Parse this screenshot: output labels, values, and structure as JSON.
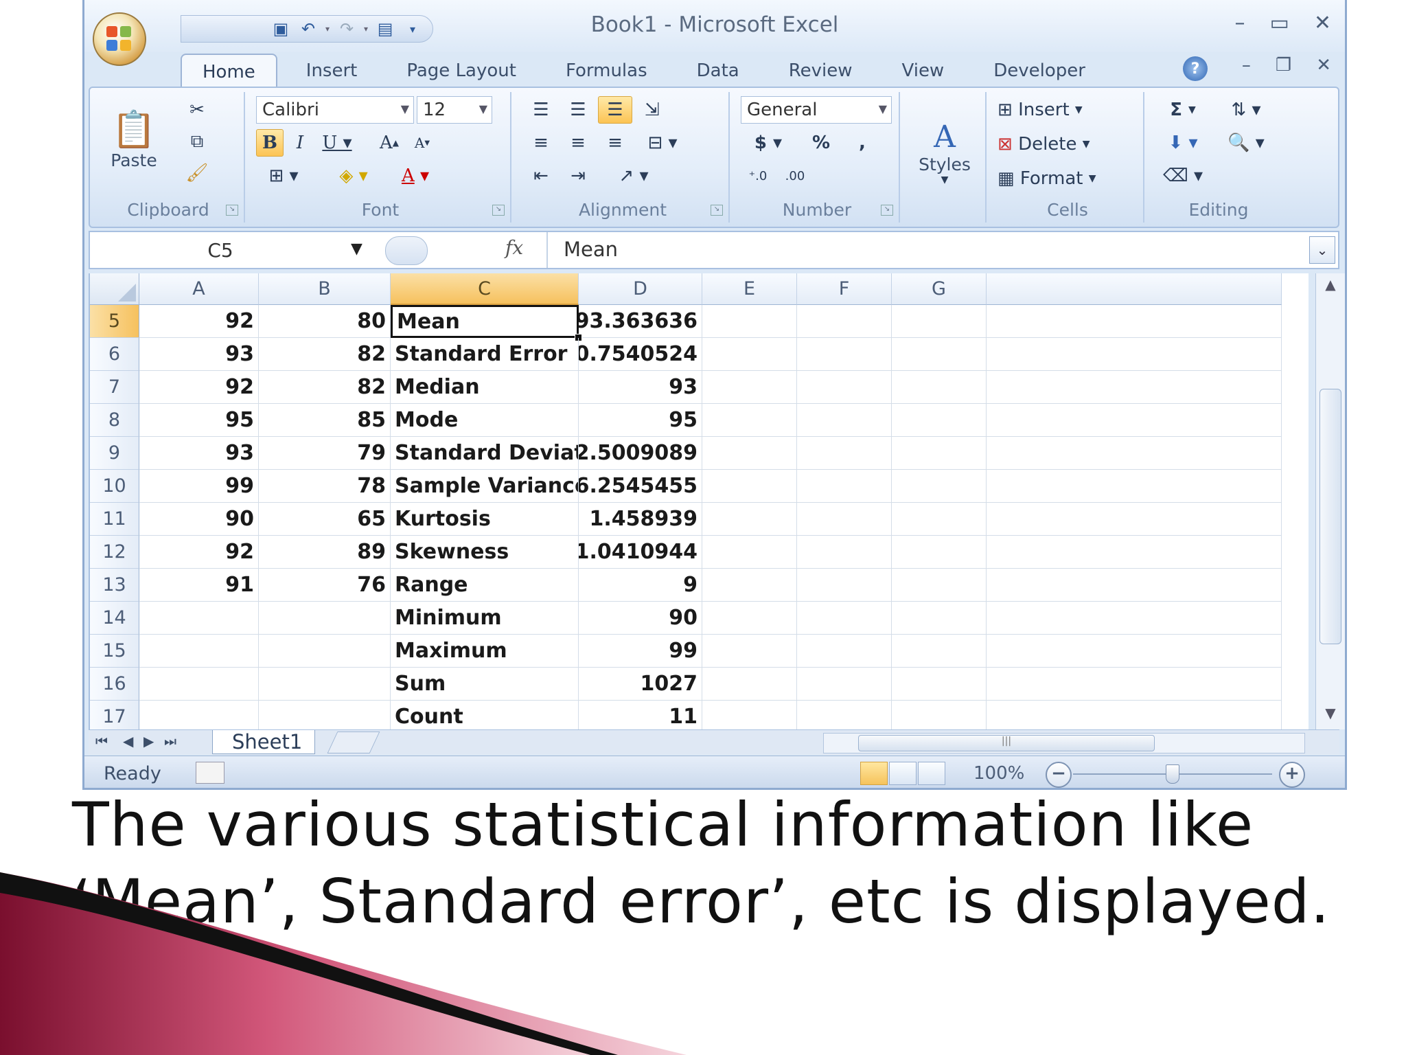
{
  "window": {
    "title": "Book1 - Microsoft Excel",
    "controls": {
      "minimize_icon": "minimize-icon",
      "maximize_icon": "maximize-icon",
      "close_icon": "close-icon"
    }
  },
  "quick_access": [
    "save-icon",
    "undo-icon",
    "redo-icon",
    "form-icon",
    "customize-icon"
  ],
  "tabs": [
    {
      "label": "Home",
      "active": true
    },
    {
      "label": "Insert"
    },
    {
      "label": "Page Layout"
    },
    {
      "label": "Formulas"
    },
    {
      "label": "Data"
    },
    {
      "label": "Review"
    },
    {
      "label": "View"
    },
    {
      "label": "Developer"
    }
  ],
  "ribbon": {
    "clipboard": {
      "label": "Clipboard",
      "paste": "Paste"
    },
    "font": {
      "label": "Font",
      "name": "Calibri",
      "size": "12"
    },
    "alignment": {
      "label": "Alignment"
    },
    "number": {
      "label": "Number",
      "format": "General",
      "currency": "$",
      "percent": "%",
      "comma": ","
    },
    "styles": {
      "label": "Styles"
    },
    "cells": {
      "label": "Cells",
      "insert": "Insert",
      "delete": "Delete",
      "format": "Format"
    },
    "editing": {
      "label": "Editing",
      "sum": "Σ"
    }
  },
  "formula_bar": {
    "name_box": "C5",
    "fx": "fx",
    "formula": "Mean"
  },
  "columns": [
    "A",
    "B",
    "C",
    "D",
    "E",
    "F",
    "G"
  ],
  "rows": [
    {
      "n": "5",
      "a": "92",
      "b": "80",
      "c": "Mean",
      "d": "93.363636"
    },
    {
      "n": "6",
      "a": "93",
      "b": "82",
      "c": "Standard Error",
      "d": "0.7540524"
    },
    {
      "n": "7",
      "a": "92",
      "b": "82",
      "c": "Median",
      "d": "93"
    },
    {
      "n": "8",
      "a": "95",
      "b": "85",
      "c": "Mode",
      "d": "95"
    },
    {
      "n": "9",
      "a": "93",
      "b": "79",
      "c": "Standard Deviatio",
      "d": "2.5009089"
    },
    {
      "n": "10",
      "a": "99",
      "b": "78",
      "c": "Sample Variance",
      "d": "6.2545455"
    },
    {
      "n": "11",
      "a": "90",
      "b": "65",
      "c": "Kurtosis",
      "d": "1.458939"
    },
    {
      "n": "12",
      "a": "92",
      "b": "89",
      "c": "Skewness",
      "d": "1.0410944"
    },
    {
      "n": "13",
      "a": "91",
      "b": "76",
      "c": "Range",
      "d": "9"
    },
    {
      "n": "14",
      "a": "",
      "b": "",
      "c": "Minimum",
      "d": "90"
    },
    {
      "n": "15",
      "a": "",
      "b": "",
      "c": "Maximum",
      "d": "99"
    },
    {
      "n": "16",
      "a": "",
      "b": "",
      "c": "Sum",
      "d": "1027"
    },
    {
      "n": "17",
      "a": "",
      "b": "",
      "c": "Count",
      "d": "11"
    }
  ],
  "sheet_tabs": [
    "Sheet1"
  ],
  "status": {
    "ready": "Ready",
    "zoom": "100%"
  },
  "caption": {
    "line1": "The various statistical information like",
    "line2": "‘Mean’, Standard error’, etc is displayed."
  },
  "colors": {
    "accent": "#f6c15e",
    "ribbon": "#dbe8f6",
    "swoosh": "#8e1538"
  }
}
